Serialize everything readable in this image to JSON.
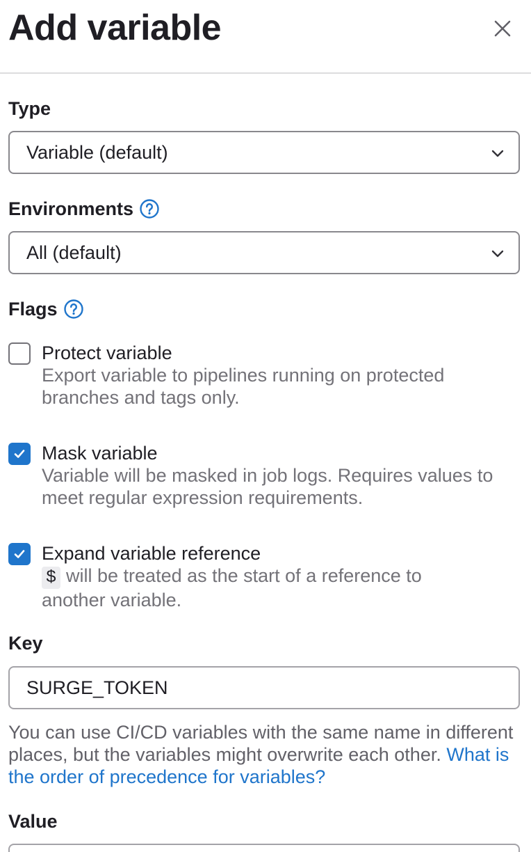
{
  "drawer": {
    "title": "Add variable",
    "close_icon": "close-icon"
  },
  "type_field": {
    "label": "Type",
    "value": "Variable (default)"
  },
  "environments_field": {
    "label": "Environments",
    "value": "All (default)",
    "help_icon": "question-circle-icon"
  },
  "flags": {
    "label": "Flags",
    "help_icon": "question-circle-icon",
    "protect": {
      "label": "Protect variable",
      "checked": false,
      "description": "Export variable to pipelines running on protected branches and tags only."
    },
    "mask": {
      "label": "Mask variable",
      "checked": true,
      "description": "Variable will be masked in job logs. Requires values to meet regular expression requirements."
    },
    "expand": {
      "label": "Expand variable reference",
      "checked": true,
      "code": "$",
      "description": "will be treated as the start of a reference to another variable."
    }
  },
  "key_field": {
    "label": "Key",
    "value": "SURGE_TOKEN",
    "help_text": "You can use CI/CD variables with the same name in different places, but the variables might overwrite each other.",
    "help_link": "What is the order of precedence for variables?"
  },
  "value_field": {
    "label": "Value"
  },
  "colors": {
    "accent": "#1f75cb",
    "border": "#89888d",
    "muted_text": "#737278"
  }
}
